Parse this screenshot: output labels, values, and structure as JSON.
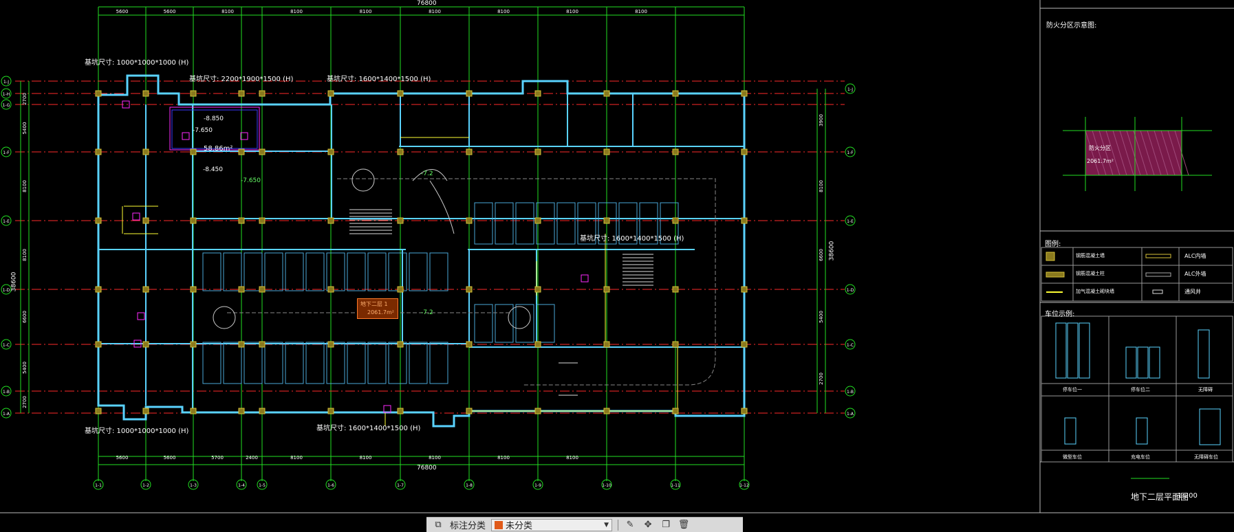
{
  "drawing": {
    "total_dim_top": "76800",
    "total_dim_bottom": "76800",
    "top_dims": [
      "5600",
      "5600",
      "8100",
      "8100",
      "8100",
      "8100",
      "8100",
      "8100",
      "8100"
    ],
    "bottom_dims": [
      "5600",
      "5600",
      "5700",
      "2400",
      "8100",
      "8100",
      "8100",
      "8100",
      "8100"
    ],
    "col_axes": [
      "1-1",
      "1-2",
      "1-3",
      "1-4",
      "1-5",
      "1-6",
      "1-7",
      "1-8",
      "1-9",
      "1-10",
      "1-11",
      "1-12"
    ],
    "row_axes_left": [
      "1-J",
      "1-H",
      "1-G",
      "1-F",
      "1-E",
      "1-D",
      "1-C",
      "1-B",
      "1-A"
    ],
    "row_axes_right": [
      "1-J",
      "1-F",
      "1-E",
      "1-D",
      "1-C",
      "1-B",
      "1-A"
    ],
    "left_dims": [
      "2700",
      "5400",
      "8100",
      "8100",
      "6600",
      "5400",
      "2700"
    ],
    "right_dims": [
      "3900",
      "8100",
      "6600",
      "5400",
      "2700"
    ],
    "right_total": "38600",
    "left_total": "38600",
    "notes": {
      "top_left_base": "基坑尺寸: 1000*1000*1000 (H)",
      "top_mid_base": "基坑尺寸: 2200*1900*1500 (H)",
      "top_right_base": "基坑尺寸: 1600*1400*1500 (H)",
      "mid_base": "基坑尺寸: 1600*1400*1500 (H)",
      "bottom_left_base": "基坑尺寸: 1000*1000*1000 (H)",
      "bottom_mid_base": "基坑尺寸: 1600*1400*1500 (H)",
      "elev_1": "-8.850",
      "elev_2": "-7.650",
      "elev_3": "-8.450",
      "elev_4": "-7.650",
      "elev_5": "-7.2",
      "elev_6": "-7.2",
      "area": "58.86m²",
      "room_tag_1": "地下二层 1",
      "room_tag_2": "2061.7m²"
    }
  },
  "right_panel": {
    "fire_zone_title": "防火分区示意图:",
    "zone_area_1": "防火分区",
    "zone_area_2": "2061.7m²",
    "legend_title": "图例:",
    "legend": [
      {
        "label": "钢筋混凝土墙",
        "right": "ALC内墙"
      },
      {
        "label": "钢筋混凝土柱",
        "right": "ALC外墙"
      },
      {
        "label": "加气混凝土砌块墙",
        "right": "通风井"
      }
    ],
    "parking_title": "车位示例:",
    "parking_types": [
      "停车位一",
      "停车位二",
      "无障碍",
      "微型车位",
      "充电车位",
      "无障碍车位"
    ],
    "plan_title": "地下二层平面图",
    "scale": "1:200"
  },
  "toolbar": {
    "annotation_label": "标注分类",
    "category_value": "未分类"
  },
  "colors": {
    "grid_red": "#ff2a2a",
    "grid_green": "#22e022",
    "wall_cyan": "#5ad3ff",
    "column_yellow": "#d7c23a",
    "magenta": "#ff2aff",
    "yellow_line": "#ffff33"
  }
}
